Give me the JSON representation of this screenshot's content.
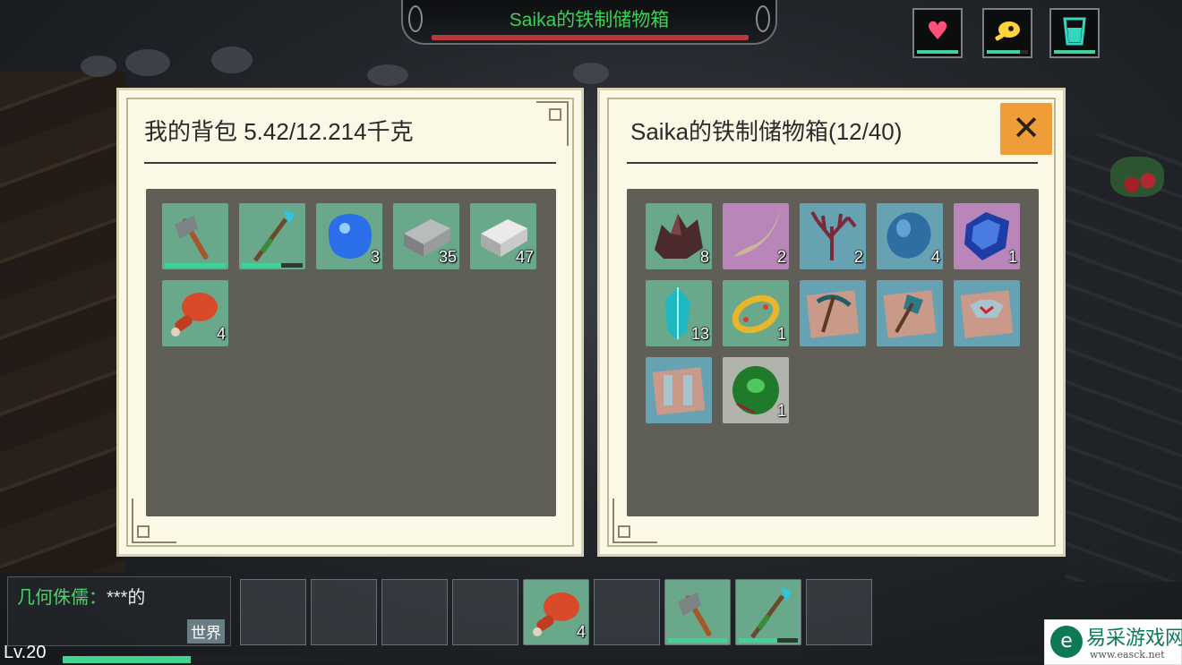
{
  "container_banner": {
    "title": "Saika的铁制储物箱"
  },
  "status_icons": [
    {
      "name": "health",
      "icon": "heart-icon",
      "level": 1.0,
      "color": "#ff4f7b"
    },
    {
      "name": "hunger",
      "icon": "meat-icon",
      "level": 0.8,
      "color": "#ffd23f"
    },
    {
      "name": "thirst",
      "icon": "water-glass-icon",
      "level": 1.0,
      "color": "#34d6c0"
    }
  ],
  "backpack": {
    "title": "我的背包  5.42/12.214千克",
    "slots": [
      {
        "icon": "stone-hammer-icon",
        "durability": 1.0
      },
      {
        "icon": "crystal-spear-icon",
        "durability": 0.65
      },
      {
        "icon": "blue-gel-icon",
        "qty": "3"
      },
      {
        "icon": "iron-ingot-icon",
        "qty": "35"
      },
      {
        "icon": "silver-ingot-icon",
        "qty": "47"
      },
      {
        "icon": "meat-leg-icon",
        "qty": "4"
      }
    ]
  },
  "chest": {
    "title": "Saika的铁制储物箱(12/40)",
    "close_label": "✕",
    "slots": [
      {
        "icon": "dark-ore-icon",
        "qty": "8"
      },
      {
        "icon": "horn-icon",
        "qty": "2"
      },
      {
        "icon": "coral-icon",
        "qty": "2"
      },
      {
        "icon": "blue-stone-icon",
        "qty": "4"
      },
      {
        "icon": "sapphire-icon",
        "qty": "1"
      },
      {
        "icon": "cyan-crystal-icon",
        "qty": "13"
      },
      {
        "icon": "gold-ring-icon",
        "qty": "1"
      },
      {
        "icon": "pickaxe-blueprint-icon",
        "qty": ""
      },
      {
        "icon": "axe-blueprint-icon",
        "qty": ""
      },
      {
        "icon": "armor-blueprint-icon",
        "qty": ""
      },
      {
        "icon": "boots-blueprint-icon",
        "qty": ""
      },
      {
        "icon": "green-fruit-icon",
        "qty": "1"
      }
    ]
  },
  "chat": {
    "sender": "几何侏儒：",
    "message": "***的",
    "channel": "世界"
  },
  "hotbar": [
    {
      "icon": "",
      "qty": ""
    },
    {
      "icon": "",
      "qty": ""
    },
    {
      "icon": "",
      "qty": ""
    },
    {
      "icon": "",
      "qty": ""
    },
    {
      "icon": "meat-leg-icon",
      "qty": "4"
    },
    {
      "icon": "",
      "qty": ""
    },
    {
      "icon": "stone-hammer-icon",
      "qty": "",
      "durability": 1.0
    },
    {
      "icon": "crystal-spear-icon",
      "qty": "",
      "durability": 0.65
    },
    {
      "icon": "",
      "qty": ""
    }
  ],
  "player": {
    "level": "Lv.20",
    "xp": 0.13
  },
  "watermark": {
    "site": "易采游戏网",
    "url": "www.easck.net"
  }
}
